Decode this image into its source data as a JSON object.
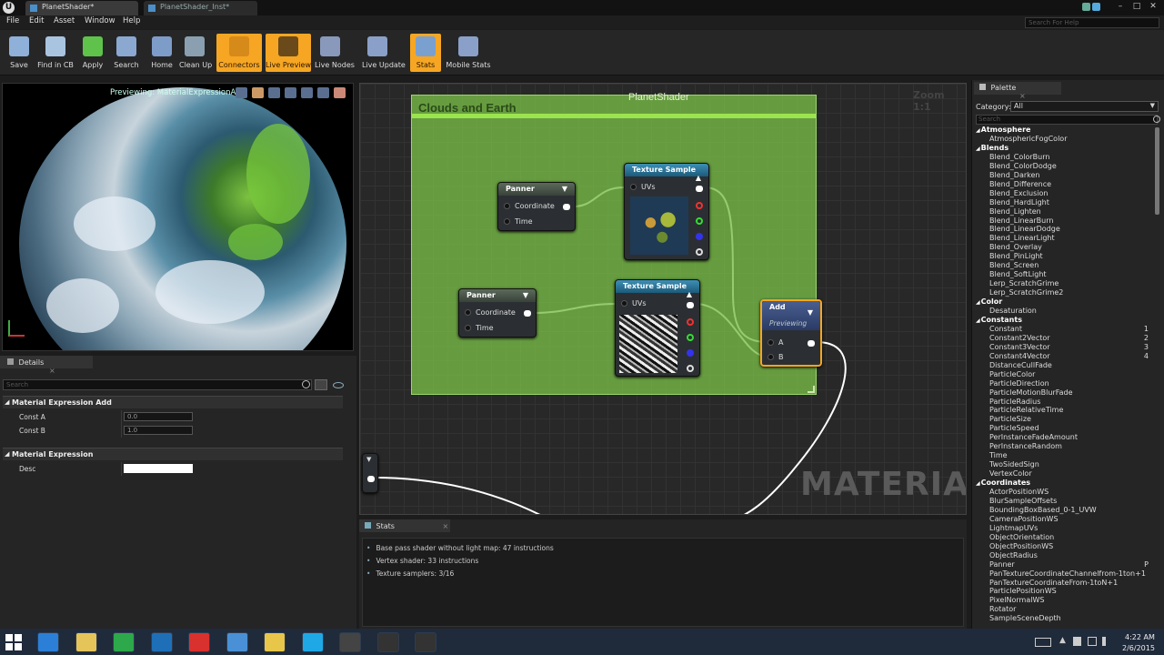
{
  "window": {
    "tabs": [
      "PlanetShader*",
      "PlanetShader_Inst*"
    ],
    "search_placeholder": "Search For Help",
    "controls": [
      "–",
      "□",
      "✕"
    ]
  },
  "menu": [
    "File",
    "Edit",
    "Asset",
    "Window",
    "Help"
  ],
  "toolbar": [
    {
      "label": "Save",
      "icon": "save-icon",
      "color": "#8fb0d8",
      "on": false
    },
    {
      "label": "Find in CB",
      "icon": "magnifier-icon",
      "color": "#a9c4df",
      "on": false
    },
    {
      "label": "Apply",
      "icon": "checkmark-icon",
      "color": "#5fc24a",
      "on": false
    },
    {
      "label": "Search",
      "icon": "binoculars-icon",
      "color": "#8aa8d0",
      "on": false
    },
    {
      "label": "Home",
      "icon": "house-icon",
      "color": "#7e9cc8",
      "on": false
    },
    {
      "label": "Clean Up",
      "icon": "broom-icon",
      "color": "#8aa0b0",
      "on": false
    },
    {
      "label": "Connectors",
      "icon": "connectors-icon",
      "color": "#d68a1a",
      "on": true
    },
    {
      "label": "Live Preview",
      "icon": "live-preview-icon",
      "color": "#6a4a1a",
      "on": true
    },
    {
      "label": "Live Nodes",
      "icon": "live-nodes-icon",
      "color": "#8899bb",
      "on": false
    },
    {
      "label": "Live Update",
      "icon": "live-update-icon",
      "color": "#8aa0c8",
      "on": false
    },
    {
      "label": "Stats",
      "icon": "stats-icon",
      "color": "#7aa0d0",
      "on": true
    },
    {
      "label": "Mobile Stats",
      "icon": "mobile-stats-icon",
      "color": "#8aa0c8",
      "on": false
    }
  ],
  "viewport": {
    "title": "Previewing: MaterialExpressionAdd"
  },
  "details": {
    "tab": "Details",
    "search_placeholder": "Search",
    "sections": [
      {
        "title": "Material Expression Add",
        "props": [
          {
            "label": "Const A",
            "value": "0.0"
          },
          {
            "label": "Const B",
            "value": "1.0"
          }
        ]
      },
      {
        "title": "Material Expression",
        "props": [
          {
            "label": "Desc",
            "value": ""
          }
        ]
      }
    ]
  },
  "graph": {
    "title": "PlanetShader",
    "comment": "Clouds and Earth",
    "zoom": "Zoom 1:1",
    "watermark": "MATERIAL",
    "nodes": {
      "panner1": {
        "title": "Panner",
        "pins": [
          "Coordinate",
          "Time"
        ]
      },
      "panner2": {
        "title": "Panner",
        "pins": [
          "Coordinate",
          "Time"
        ]
      },
      "tex1": {
        "title": "Texture Sample",
        "pin": "UVs"
      },
      "tex2": {
        "title": "Texture Sample",
        "pin": "UVs"
      },
      "add": {
        "title": "Add",
        "subtitle": "Previewing",
        "pins": [
          "A",
          "B"
        ]
      }
    }
  },
  "stats": {
    "tab": "Stats",
    "lines": [
      "Base pass shader without light map: 47 instructions",
      "Vertex shader: 33 instructions",
      "Texture samplers: 3/16"
    ]
  },
  "palette": {
    "tab": "Palette",
    "category_label": "Category:",
    "category_value": "All",
    "search_placeholder": "Search",
    "items": [
      {
        "t": "Atmosphere",
        "c": 1,
        "k": ""
      },
      {
        "t": "AtmosphericFogColor",
        "c": 0,
        "k": ""
      },
      {
        "t": "Blends",
        "c": 1,
        "k": ""
      },
      {
        "t": "Blend_ColorBurn",
        "c": 0,
        "k": ""
      },
      {
        "t": "Blend_ColorDodge",
        "c": 0,
        "k": ""
      },
      {
        "t": "Blend_Darken",
        "c": 0,
        "k": ""
      },
      {
        "t": "Blend_Difference",
        "c": 0,
        "k": ""
      },
      {
        "t": "Blend_Exclusion",
        "c": 0,
        "k": ""
      },
      {
        "t": "Blend_HardLight",
        "c": 0,
        "k": ""
      },
      {
        "t": "Blend_Lighten",
        "c": 0,
        "k": ""
      },
      {
        "t": "Blend_LinearBurn",
        "c": 0,
        "k": ""
      },
      {
        "t": "Blend_LinearDodge",
        "c": 0,
        "k": ""
      },
      {
        "t": "Blend_LinearLight",
        "c": 0,
        "k": ""
      },
      {
        "t": "Blend_Overlay",
        "c": 0,
        "k": ""
      },
      {
        "t": "Blend_PinLight",
        "c": 0,
        "k": ""
      },
      {
        "t": "Blend_Screen",
        "c": 0,
        "k": ""
      },
      {
        "t": "Blend_SoftLight",
        "c": 0,
        "k": ""
      },
      {
        "t": "Lerp_ScratchGrime",
        "c": 0,
        "k": ""
      },
      {
        "t": "Lerp_ScratchGrime2",
        "c": 0,
        "k": ""
      },
      {
        "t": "Color",
        "c": 1,
        "k": ""
      },
      {
        "t": "Desaturation",
        "c": 0,
        "k": ""
      },
      {
        "t": "Constants",
        "c": 1,
        "k": ""
      },
      {
        "t": "Constant",
        "c": 0,
        "k": "1"
      },
      {
        "t": "Constant2Vector",
        "c": 0,
        "k": "2"
      },
      {
        "t": "Constant3Vector",
        "c": 0,
        "k": "3"
      },
      {
        "t": "Constant4Vector",
        "c": 0,
        "k": "4"
      },
      {
        "t": "DistanceCullFade",
        "c": 0,
        "k": ""
      },
      {
        "t": "ParticleColor",
        "c": 0,
        "k": ""
      },
      {
        "t": "ParticleDirection",
        "c": 0,
        "k": ""
      },
      {
        "t": "ParticleMotionBlurFade",
        "c": 0,
        "k": ""
      },
      {
        "t": "ParticleRadius",
        "c": 0,
        "k": ""
      },
      {
        "t": "ParticleRelativeTime",
        "c": 0,
        "k": ""
      },
      {
        "t": "ParticleSize",
        "c": 0,
        "k": ""
      },
      {
        "t": "ParticleSpeed",
        "c": 0,
        "k": ""
      },
      {
        "t": "PerInstanceFadeAmount",
        "c": 0,
        "k": ""
      },
      {
        "t": "PerInstanceRandom",
        "c": 0,
        "k": ""
      },
      {
        "t": "Time",
        "c": 0,
        "k": ""
      },
      {
        "t": "TwoSidedSign",
        "c": 0,
        "k": ""
      },
      {
        "t": "VertexColor",
        "c": 0,
        "k": ""
      },
      {
        "t": "Coordinates",
        "c": 1,
        "k": ""
      },
      {
        "t": "ActorPositionWS",
        "c": 0,
        "k": ""
      },
      {
        "t": "BlurSampleOffsets",
        "c": 0,
        "k": ""
      },
      {
        "t": "BoundingBoxBased_0-1_UVW",
        "c": 0,
        "k": ""
      },
      {
        "t": "CameraPositionWS",
        "c": 0,
        "k": ""
      },
      {
        "t": "LightmapUVs",
        "c": 0,
        "k": ""
      },
      {
        "t": "ObjectOrientation",
        "c": 0,
        "k": ""
      },
      {
        "t": "ObjectPositionWS",
        "c": 0,
        "k": ""
      },
      {
        "t": "ObjectRadius",
        "c": 0,
        "k": ""
      },
      {
        "t": "Panner",
        "c": 0,
        "k": "P"
      },
      {
        "t": "PanTextureCoordinateChannelfrom-1ton+1",
        "c": 0,
        "k": ""
      },
      {
        "t": "PanTextureCoordinateFrom-1toN+1",
        "c": 0,
        "k": ""
      },
      {
        "t": "ParticlePositionWS",
        "c": 0,
        "k": ""
      },
      {
        "t": "PixelNormalWS",
        "c": 0,
        "k": ""
      },
      {
        "t": "Rotator",
        "c": 0,
        "k": ""
      },
      {
        "t": "SampleSceneDepth",
        "c": 0,
        "k": ""
      }
    ]
  },
  "taskbar": {
    "time": "4:22 AM",
    "date": "2/6/2015",
    "apps": [
      {
        "name": "internet-explorer-icon",
        "color": "#2b7fd6"
      },
      {
        "name": "file-explorer-icon",
        "color": "#e5c45a"
      },
      {
        "name": "calculator-icon",
        "color": "#2da84a"
      },
      {
        "name": "photoshop-icon",
        "color": "#1e6fb8"
      },
      {
        "name": "vivaldi-icon",
        "color": "#d9312e"
      },
      {
        "name": "settings-icon",
        "color": "#4a90d6"
      },
      {
        "name": "folder-icon",
        "color": "#e8c64a"
      },
      {
        "name": "skype-icon",
        "color": "#1fa8e6"
      },
      {
        "name": "obs-icon",
        "color": "#444"
      },
      {
        "name": "epic-games-icon",
        "color": "#333"
      },
      {
        "name": "unreal-editor-icon",
        "color": "#333"
      }
    ]
  }
}
